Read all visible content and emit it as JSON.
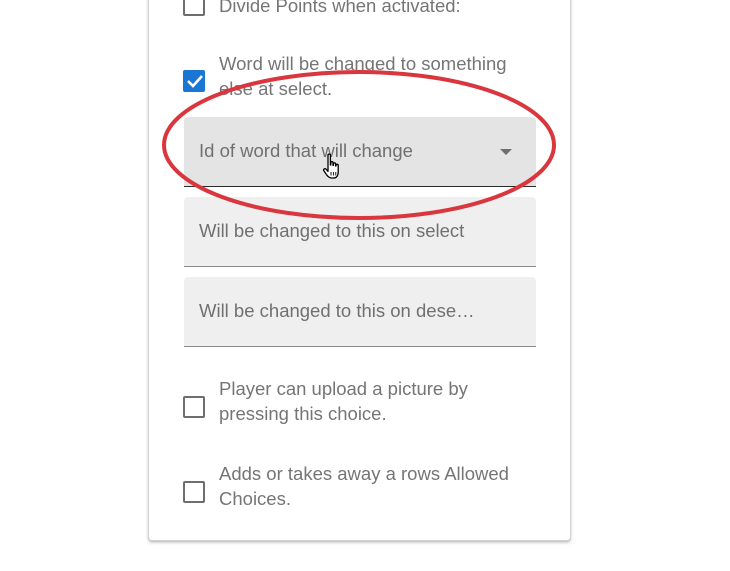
{
  "options": [
    {
      "label": "Divide Points when activated:",
      "checked": false
    },
    {
      "label": "Word will be changed to something else at select.",
      "checked": true
    },
    {
      "label": "Player can upload a picture by pressing this choice.",
      "checked": false
    },
    {
      "label": "Adds or takes away a rows Allowed Choices.",
      "checked": false
    }
  ],
  "fields": {
    "word_id_select": {
      "placeholder": "Id of word that will change",
      "icon": "dropdown-arrow-icon"
    },
    "on_select_input": {
      "placeholder": "Will be changed to this on select"
    },
    "on_deselect_input": {
      "placeholder": "Will be changed to this on dese…"
    }
  },
  "annotation": {
    "shape": "ellipse",
    "color": "#d9363e"
  },
  "colors": {
    "checkbox_checked": "#1976d2",
    "field_background": "#efefef",
    "text": "#757575"
  }
}
